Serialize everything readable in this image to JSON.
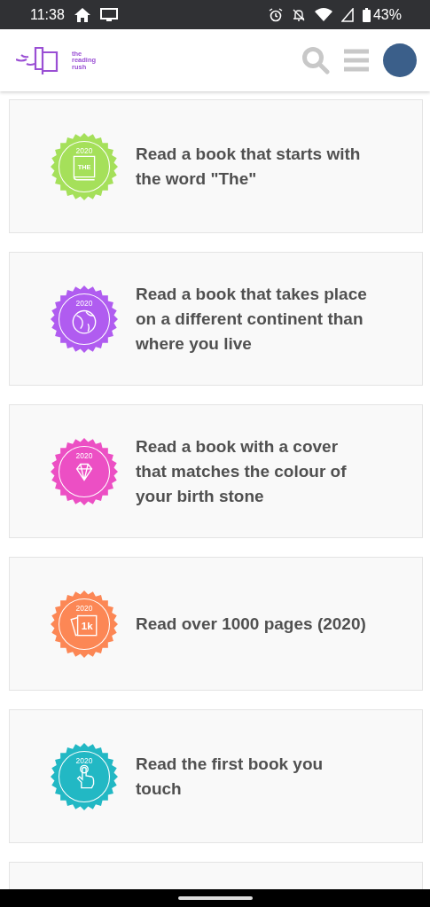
{
  "status_bar": {
    "time": "11:38",
    "battery": "43%"
  },
  "header": {
    "logo_lines": [
      "the",
      "reading",
      "rush"
    ]
  },
  "challenges": [
    {
      "kind": "book",
      "color": "#a5e05a",
      "year": "2020",
      "badge_text": "THE",
      "title": "Read a book that starts with the word \"The\""
    },
    {
      "kind": "globe",
      "color": "#b05cf0",
      "year": "2020",
      "title": "Read a book that takes place on a different continent than where you live"
    },
    {
      "kind": "gem",
      "color": "#ec4fc4",
      "year": "2020",
      "title": "Read a book with a cover that matches the colour of your birth stone"
    },
    {
      "kind": "pages",
      "color": "#fc8755",
      "year": "2020",
      "badge_text": "1k",
      "title": "Read over 1000 pages (2020)"
    },
    {
      "kind": "hand",
      "color": "#22b8c4",
      "year": "2020",
      "title": "Read the first book you touch"
    }
  ]
}
